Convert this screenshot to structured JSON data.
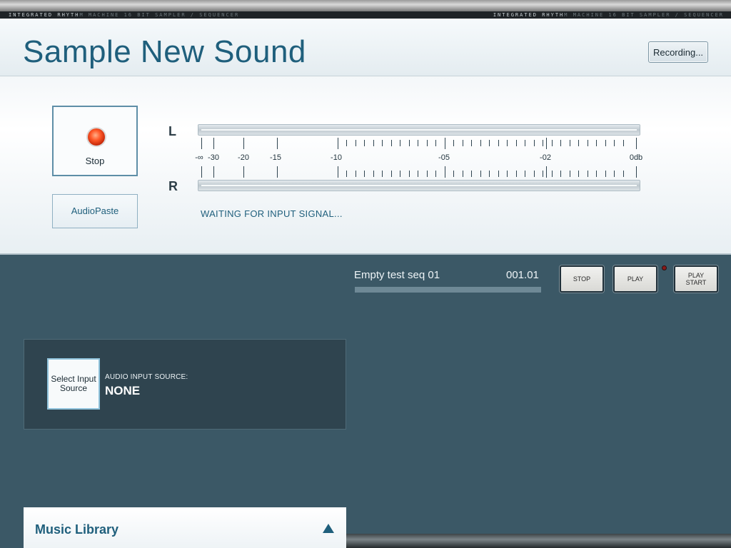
{
  "brand": {
    "left_bright": "INTEGRATED RHYTH",
    "left_dim": "M MACHINE  16 BIT SAMPLER / SEQUENCER",
    "right_bright": "INTEGRATED RHYTH",
    "right_dim": "M MACHINE  16 BIT SAMPLER / SEQUENCER"
  },
  "header": {
    "title": "Sample New Sound",
    "recording_button": "Recording..."
  },
  "sampler": {
    "stop_label": "Stop",
    "audiopaste_label": "AudioPaste",
    "left_channel": "L",
    "right_channel": "R",
    "scale_labels": [
      "-∞",
      "-30",
      "-20",
      "-15",
      "-10",
      "-05",
      "-02",
      "0db"
    ],
    "status": "WAITING FOR INPUT SIGNAL..."
  },
  "transport": {
    "sequence_name": "Empty test seq 01",
    "position": "001.01",
    "progress": 0,
    "stop_label": "STOP",
    "play_label": "PLAY",
    "play_start_label": "PLAY START"
  },
  "input_source": {
    "button_label": "Select Input Source",
    "caption": "AUDIO INPUT SOURCE:",
    "value": "NONE"
  },
  "library": {
    "title": "Music Library",
    "expand_icon": "triangle-up-icon"
  },
  "colors": {
    "accent": "#1f5f7c",
    "background": "#3b5866",
    "led_red": "#ff5a2a"
  }
}
